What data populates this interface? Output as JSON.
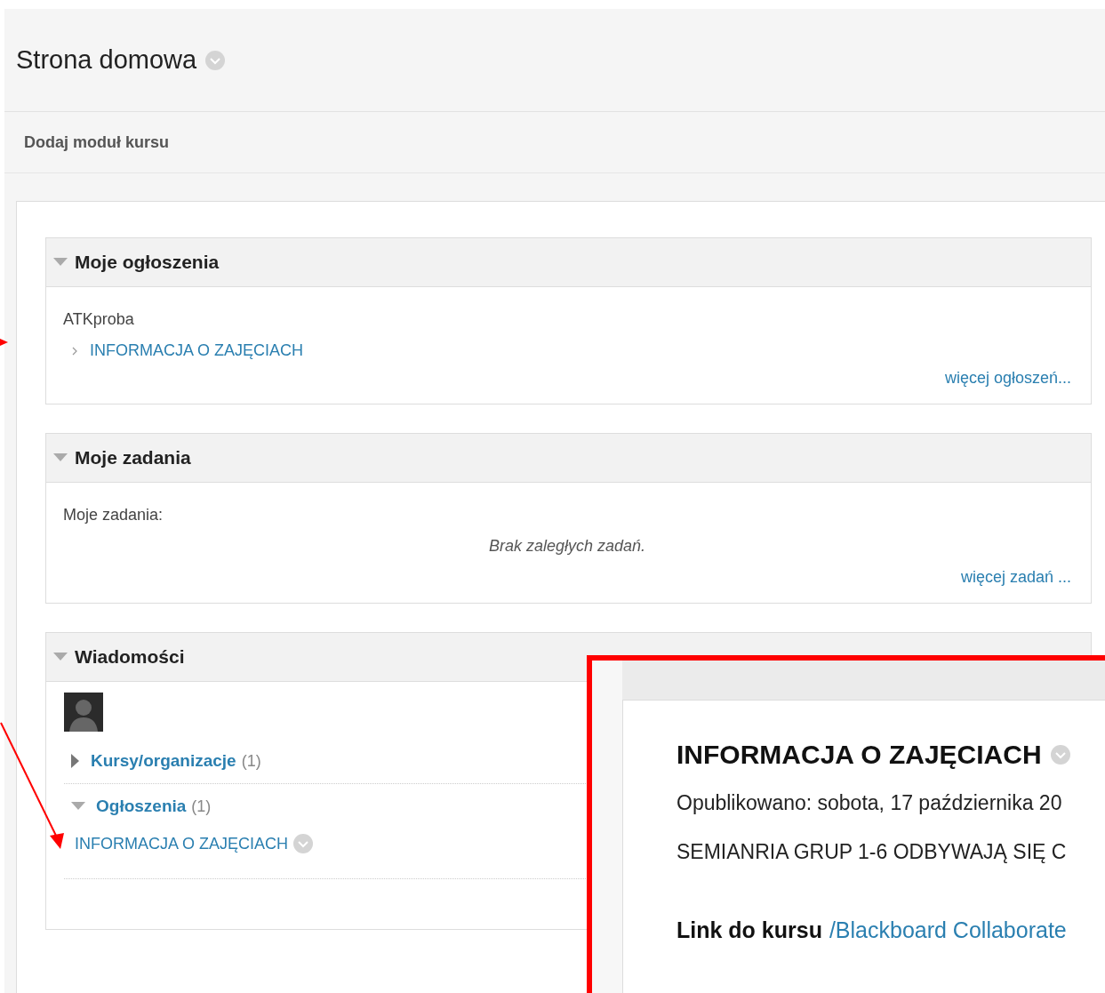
{
  "page": {
    "title": "Strona domowa"
  },
  "toolbar": {
    "action": "Dodaj moduł kursu"
  },
  "modules": [
    {
      "kind": "announcements",
      "title": "Moje ogłoszenia",
      "expanded": true,
      "course": "ATKproba",
      "items": [
        "INFORMACJA O ZAJĘCIACH"
      ],
      "more": "więcej ogłoszeń..."
    },
    {
      "kind": "tasks",
      "title": "Moje zadania",
      "expanded": true,
      "label": "Moje zadania:",
      "empty": "Brak zaległych zadań.",
      "more": "więcej zadań ..."
    },
    {
      "kind": "messages",
      "title": "Wiadomości",
      "expanded": true,
      "tree": [
        {
          "label": "Kursy/organizacje",
          "count": "(1)",
          "expanded": false
        },
        {
          "label": "Ogłoszenia",
          "count": "(1)",
          "expanded": true,
          "children": [
            {
              "label": "INFORMACJA O ZAJĘCIACH"
            }
          ]
        }
      ]
    }
  ],
  "overlay": {
    "title": "INFORMACJA O ZAJĘCIACH",
    "posted": "Opublikowano: sobota, 17 października 20",
    "body": "SEMIANRIA GRUP 1-6 ODBYWAJĄ SIĘ C",
    "link_label": "Link do kursu",
    "link": "/Blackboard Collaborate"
  }
}
